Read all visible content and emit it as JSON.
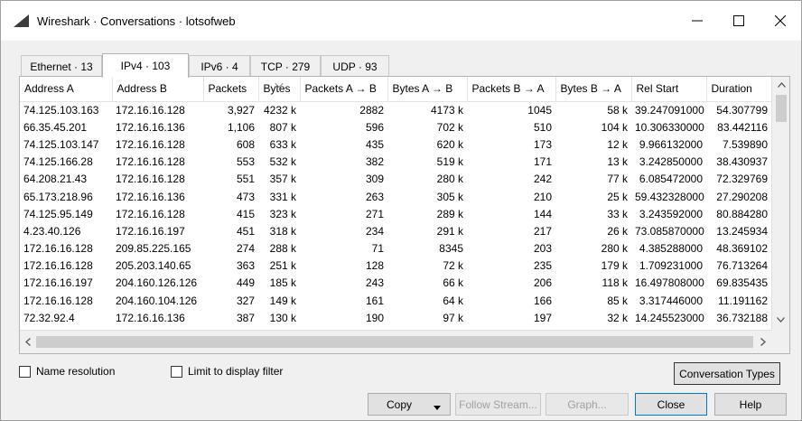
{
  "window": {
    "title": "Wireshark · Conversations · lotsofweb"
  },
  "tabs": [
    {
      "label": "Ethernet · 13"
    },
    {
      "label": "IPv4 · 103"
    },
    {
      "label": "IPv6 · 4"
    },
    {
      "label": "TCP · 279"
    },
    {
      "label": "UDP · 93"
    }
  ],
  "table": {
    "columns": [
      "Address A",
      "Address B",
      "Packets",
      "Bytes",
      "Packets A → B",
      "Bytes A → B",
      "Packets B → A",
      "Bytes B → A",
      "Rel Start",
      "Duration"
    ],
    "rows": [
      [
        "74.125.103.163",
        "172.16.16.128",
        "3,927",
        "4232 k",
        "2882",
        "4173 k",
        "1045",
        "58 k",
        "39.247091000",
        "54.307799"
      ],
      [
        "66.35.45.201",
        "172.16.16.136",
        "1,106",
        "807 k",
        "596",
        "702 k",
        "510",
        "104 k",
        "10.306330000",
        "83.442116"
      ],
      [
        "74.125.103.147",
        "172.16.16.128",
        "608",
        "633 k",
        "435",
        "620 k",
        "173",
        "12 k",
        "9.966132000",
        "7.539890"
      ],
      [
        "74.125.166.28",
        "172.16.16.128",
        "553",
        "532 k",
        "382",
        "519 k",
        "171",
        "13 k",
        "3.242850000",
        "38.430937"
      ],
      [
        "64.208.21.43",
        "172.16.16.128",
        "551",
        "357 k",
        "309",
        "280 k",
        "242",
        "77 k",
        "6.085472000",
        "72.329769"
      ],
      [
        "65.173.218.96",
        "172.16.16.136",
        "473",
        "331 k",
        "263",
        "305 k",
        "210",
        "25 k",
        "59.432328000",
        "27.290208"
      ],
      [
        "74.125.95.149",
        "172.16.16.128",
        "415",
        "323 k",
        "271",
        "289 k",
        "144",
        "33 k",
        "3.243592000",
        "80.884280"
      ],
      [
        "4.23.40.126",
        "172.16.16.197",
        "451",
        "318 k",
        "234",
        "291 k",
        "217",
        "26 k",
        "73.085870000",
        "13.245934"
      ],
      [
        "172.16.16.128",
        "209.85.225.165",
        "274",
        "288 k",
        "71",
        "8345",
        "203",
        "280 k",
        "4.385288000",
        "48.369102"
      ],
      [
        "172.16.16.128",
        "205.203.140.65",
        "363",
        "251 k",
        "128",
        "72 k",
        "235",
        "179 k",
        "1.709231000",
        "76.713264"
      ],
      [
        "172.16.16.197",
        "204.160.126.126",
        "449",
        "185 k",
        "243",
        "66 k",
        "206",
        "118 k",
        "16.497808000",
        "69.835435"
      ],
      [
        "172.16.16.128",
        "204.160.104.126",
        "327",
        "149 k",
        "161",
        "64 k",
        "166",
        "85 k",
        "3.317446000",
        "11.191162"
      ],
      [
        "72.32.92.4",
        "172.16.16.136",
        "387",
        "130 k",
        "190",
        "97 k",
        "197",
        "32 k",
        "14.245523000",
        "36.732188"
      ]
    ]
  },
  "options": {
    "name_resolution_label": "Name resolution",
    "limit_filter_label": "Limit to display filter"
  },
  "buttons": {
    "conversation_types": "Conversation Types",
    "copy": "Copy",
    "follow_stream": "Follow Stream...",
    "graph": "Graph...",
    "close": "Close",
    "help": "Help"
  },
  "icons": {
    "app": "wireshark-fin-icon",
    "minimize": "minimize-icon",
    "maximize": "maximize-icon",
    "close": "close-icon",
    "sort": "sort-desc-icon"
  }
}
